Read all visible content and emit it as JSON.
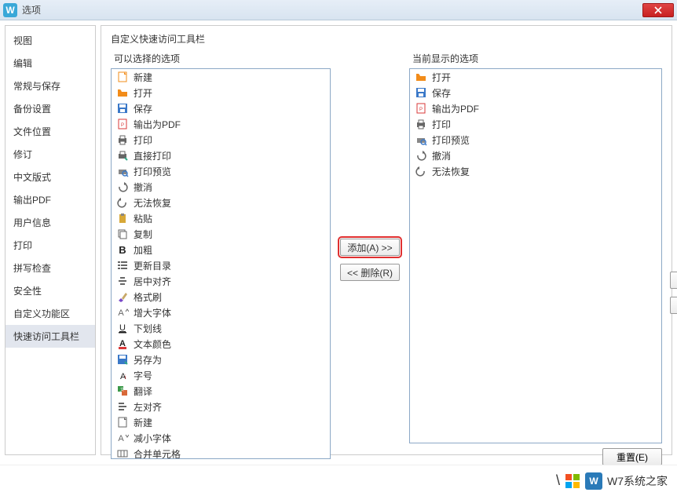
{
  "titlebar": {
    "icon_letter": "W",
    "title": "选项"
  },
  "sidebar": {
    "items": [
      {
        "label": "视图"
      },
      {
        "label": "编辑"
      },
      {
        "label": "常规与保存"
      },
      {
        "label": "备份设置"
      },
      {
        "label": "文件位置"
      },
      {
        "label": "修订"
      },
      {
        "label": "中文版式"
      },
      {
        "label": "输出PDF"
      },
      {
        "label": "用户信息"
      },
      {
        "label": "打印"
      },
      {
        "label": "拼写检查"
      },
      {
        "label": "安全性"
      },
      {
        "label": "自定义功能区"
      },
      {
        "label": "快速访问工具栏",
        "selected": true
      }
    ]
  },
  "main": {
    "section_title": "自定义快速访问工具栏",
    "available_label": "可以选择的选项",
    "current_label": "当前显示的选项",
    "available_items": [
      {
        "icon": "new",
        "label": "新建"
      },
      {
        "icon": "open",
        "label": "打开"
      },
      {
        "icon": "save",
        "label": "保存"
      },
      {
        "icon": "pdf",
        "label": "输出为PDF"
      },
      {
        "icon": "print",
        "label": "打印"
      },
      {
        "icon": "printdirect",
        "label": "直接打印"
      },
      {
        "icon": "printpreview",
        "label": "打印预览"
      },
      {
        "icon": "undo",
        "label": "撤消"
      },
      {
        "icon": "redo",
        "label": "无法恢复"
      },
      {
        "icon": "paste",
        "label": "粘贴"
      },
      {
        "icon": "copy",
        "label": "复制"
      },
      {
        "icon": "bold",
        "label": "加粗"
      },
      {
        "icon": "toc",
        "label": "更新目录"
      },
      {
        "icon": "center",
        "label": "居中对齐"
      },
      {
        "icon": "brush",
        "label": "格式刷"
      },
      {
        "icon": "fontup",
        "label": "增大字体"
      },
      {
        "icon": "underline",
        "label": "下划线"
      },
      {
        "icon": "textcolor",
        "label": "文本颜色"
      },
      {
        "icon": "saveas",
        "label": "另存为"
      },
      {
        "icon": "fontsize",
        "label": "字号"
      },
      {
        "icon": "translate",
        "label": "翻译"
      },
      {
        "icon": "left",
        "label": "左对齐"
      },
      {
        "icon": "new2",
        "label": "新建"
      },
      {
        "icon": "fontdown",
        "label": "减小字体"
      },
      {
        "icon": "merge",
        "label": "合并单元格"
      }
    ],
    "current_items": [
      {
        "icon": "open",
        "label": "打开"
      },
      {
        "icon": "save",
        "label": "保存"
      },
      {
        "icon": "pdf",
        "label": "输出为PDF"
      },
      {
        "icon": "print",
        "label": "打印"
      },
      {
        "icon": "printpreview",
        "label": "打印预览"
      },
      {
        "icon": "undo",
        "label": "撤消"
      },
      {
        "icon": "redo",
        "label": "无法恢复"
      }
    ],
    "add_label": "添加(A) >>",
    "remove_label": "<< 删除(R)",
    "reset_label": "重置(E)",
    "up_arrow": "▲",
    "down_arrow": "▼"
  },
  "footer": {
    "text": "W7系统之家",
    "url": "www.w7xitong.com",
    "logo_letter": "W"
  },
  "icons": {
    "new": "#f28c1a",
    "open": "#f28c1a",
    "save": "#3a78c8",
    "pdf": "#d83838",
    "print": "#666",
    "printdirect": "#666",
    "printpreview": "#3a78c8",
    "undo": "#666",
    "redo": "#666",
    "paste": "#d8a838",
    "copy": "#666",
    "bold": "#222",
    "toc": "#666",
    "center": "#666",
    "brush": "#7848c8",
    "fontup": "#666",
    "underline": "#222",
    "textcolor": "#d83838",
    "saveas": "#3a78c8",
    "fontsize": "#d83838",
    "translate": "#3a9848",
    "left": "#666",
    "new2": "#666",
    "fontdown": "#666",
    "merge": "#666"
  }
}
